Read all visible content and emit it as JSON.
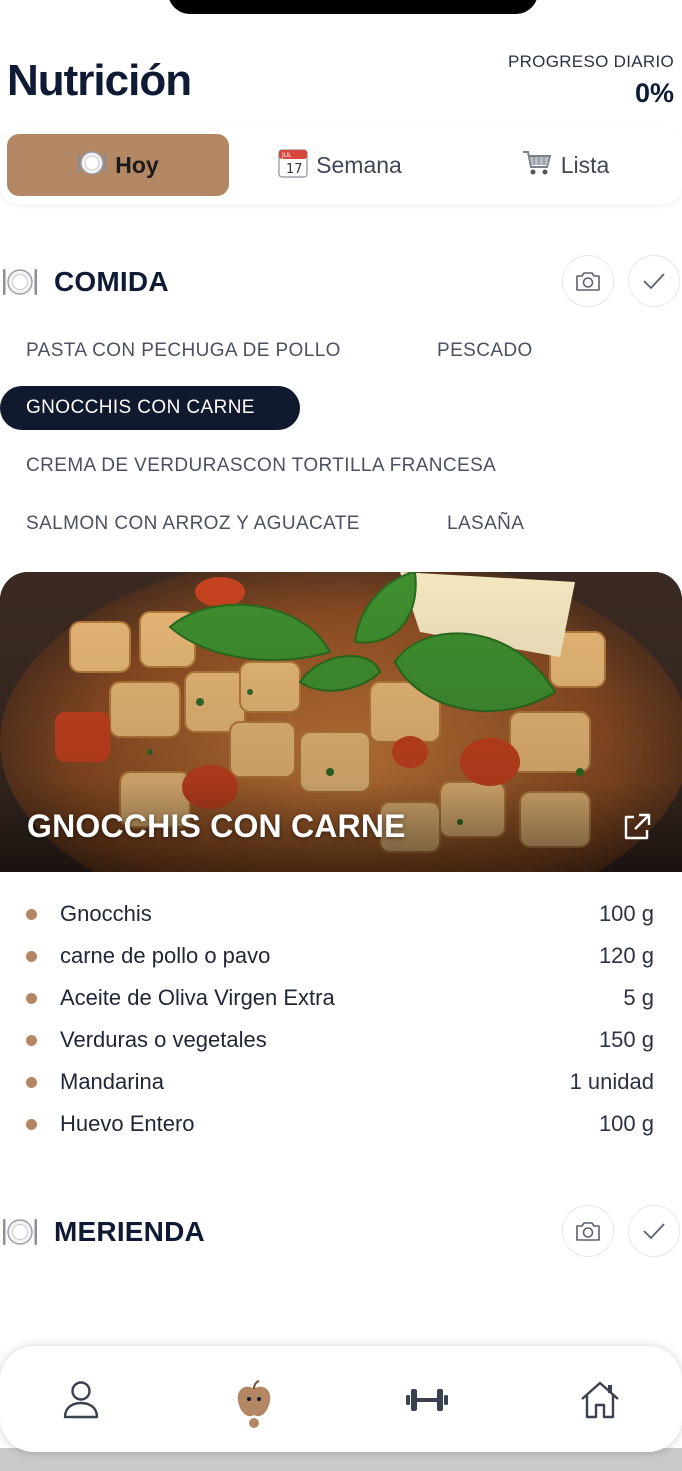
{
  "header": {
    "title": "Nutrición",
    "progress_label": "PROGRESO DIARIO",
    "progress_value": "0%"
  },
  "tabs": [
    {
      "label": "Hoy",
      "icon": "plate-icon",
      "active": true
    },
    {
      "label": "Semana",
      "icon": "calendar-icon",
      "active": false
    },
    {
      "label": "Lista",
      "icon": "cart-icon",
      "active": false
    }
  ],
  "calendar_icon_text": {
    "month": "JUL",
    "day": "17"
  },
  "meal_comida": {
    "title": "COMIDA",
    "options": [
      "PASTA CON PECHUGA DE POLLO",
      "PESCADO",
      "GNOCCHIS  CON CARNE",
      "CREMA DE VERDURASCON TORTILLA FRANCESA",
      "SALMON CON ARROZ Y AGUACATE",
      "LASAÑA"
    ],
    "selected_option": "GNOCCHIS  CON CARNE",
    "recipe_title": "GNOCCHIS  CON CARNE",
    "ingredients": [
      {
        "name": "Gnocchis",
        "qty": "100 g"
      },
      {
        "name": "carne de pollo o pavo",
        "qty": "120 g"
      },
      {
        "name": "Aceite de Oliva Virgen Extra",
        "qty": "5 g"
      },
      {
        "name": "Verduras o vegetales",
        "qty": "150 g"
      },
      {
        "name": "Mandarina",
        "qty": "1 unidad"
      },
      {
        "name": "Huevo Entero",
        "qty": "100 g"
      }
    ]
  },
  "meal_merienda": {
    "title": "MERIENDA"
  },
  "bottom_nav": [
    {
      "name": "profile",
      "icon": "person-icon",
      "active": false
    },
    {
      "name": "nutrition",
      "icon": "apple-icon",
      "active": true
    },
    {
      "name": "training",
      "icon": "dumbbell-icon",
      "active": false
    },
    {
      "name": "home",
      "icon": "house-icon",
      "active": false
    }
  ],
  "colors": {
    "accent": "#b48764",
    "dark": "#10192e",
    "text": "#14213a"
  }
}
